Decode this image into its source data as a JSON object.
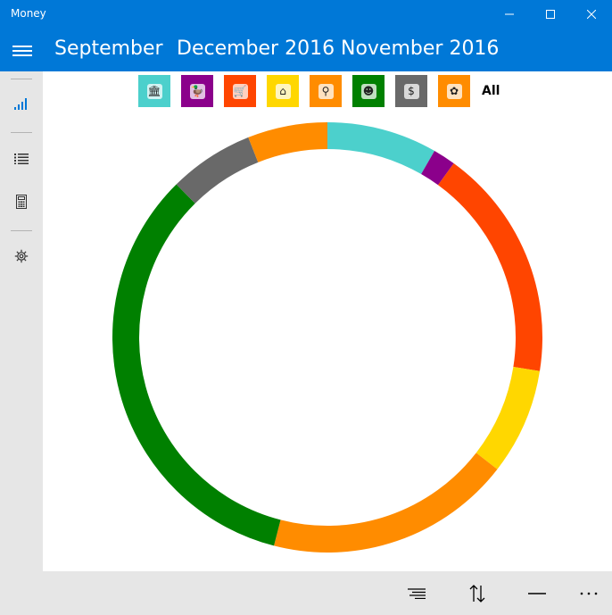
{
  "window": {
    "title": "Money",
    "controls": [
      "minimize-icon",
      "maximize-icon",
      "close-icon"
    ]
  },
  "header": {
    "periods": [
      {
        "label": "September"
      },
      {
        "label": "December 2016"
      },
      {
        "label": "November 2016"
      }
    ]
  },
  "sidebar": {
    "items": [
      {
        "icon": "chart-icon"
      },
      {
        "icon": "list-icon"
      },
      {
        "icon": "calculator-icon"
      },
      {
        "icon": "gear-icon"
      }
    ]
  },
  "filters": {
    "categories": [
      {
        "icon": "bank-icon",
        "glyph": "🏛",
        "color": "#4cd0cc"
      },
      {
        "icon": "duck-icon",
        "glyph": "🦆",
        "color": "#8b008b"
      },
      {
        "icon": "cart-icon",
        "glyph": "🛒",
        "color": "#ff4500"
      },
      {
        "icon": "house-icon",
        "glyph": "⌂",
        "color": "#ffd700"
      },
      {
        "icon": "magnifier-icon",
        "glyph": "⚲",
        "color": "#ff8c00"
      },
      {
        "icon": "alien-icon",
        "glyph": "☻",
        "color": "#008000"
      },
      {
        "icon": "moneybag-icon",
        "glyph": "$",
        "color": "#696969"
      },
      {
        "icon": "flower-icon",
        "glyph": "✿",
        "color": "#ff8c00"
      }
    ],
    "all_label": "All"
  },
  "chart_data": {
    "type": "pie",
    "style": "donut",
    "slices": [
      {
        "category": "bank-icon",
        "color": "#4cd0cc",
        "share": 8.3
      },
      {
        "category": "duck-icon",
        "color": "#8b008b",
        "share": 1.7
      },
      {
        "category": "cart-icon",
        "color": "#ff4500",
        "share": 17.5
      },
      {
        "category": "house-icon",
        "color": "#ffd700",
        "share": 8.0
      },
      {
        "category": "magnifier-icon",
        "color": "#ff8c00",
        "share": 18.5
      },
      {
        "category": "alien-icon",
        "color": "#008000",
        "share": 33.6
      },
      {
        "category": "moneybag-icon",
        "color": "#696969",
        "share": 6.4
      },
      {
        "category": "flower-icon",
        "color": "#ff8c00",
        "share": 6.0
      }
    ]
  },
  "toolbar": {
    "buttons": [
      {
        "icon": "sort-lines-icon"
      },
      {
        "icon": "swap-vertical-icon"
      },
      {
        "icon": "minus-icon"
      },
      {
        "icon": "more-icon"
      }
    ]
  }
}
